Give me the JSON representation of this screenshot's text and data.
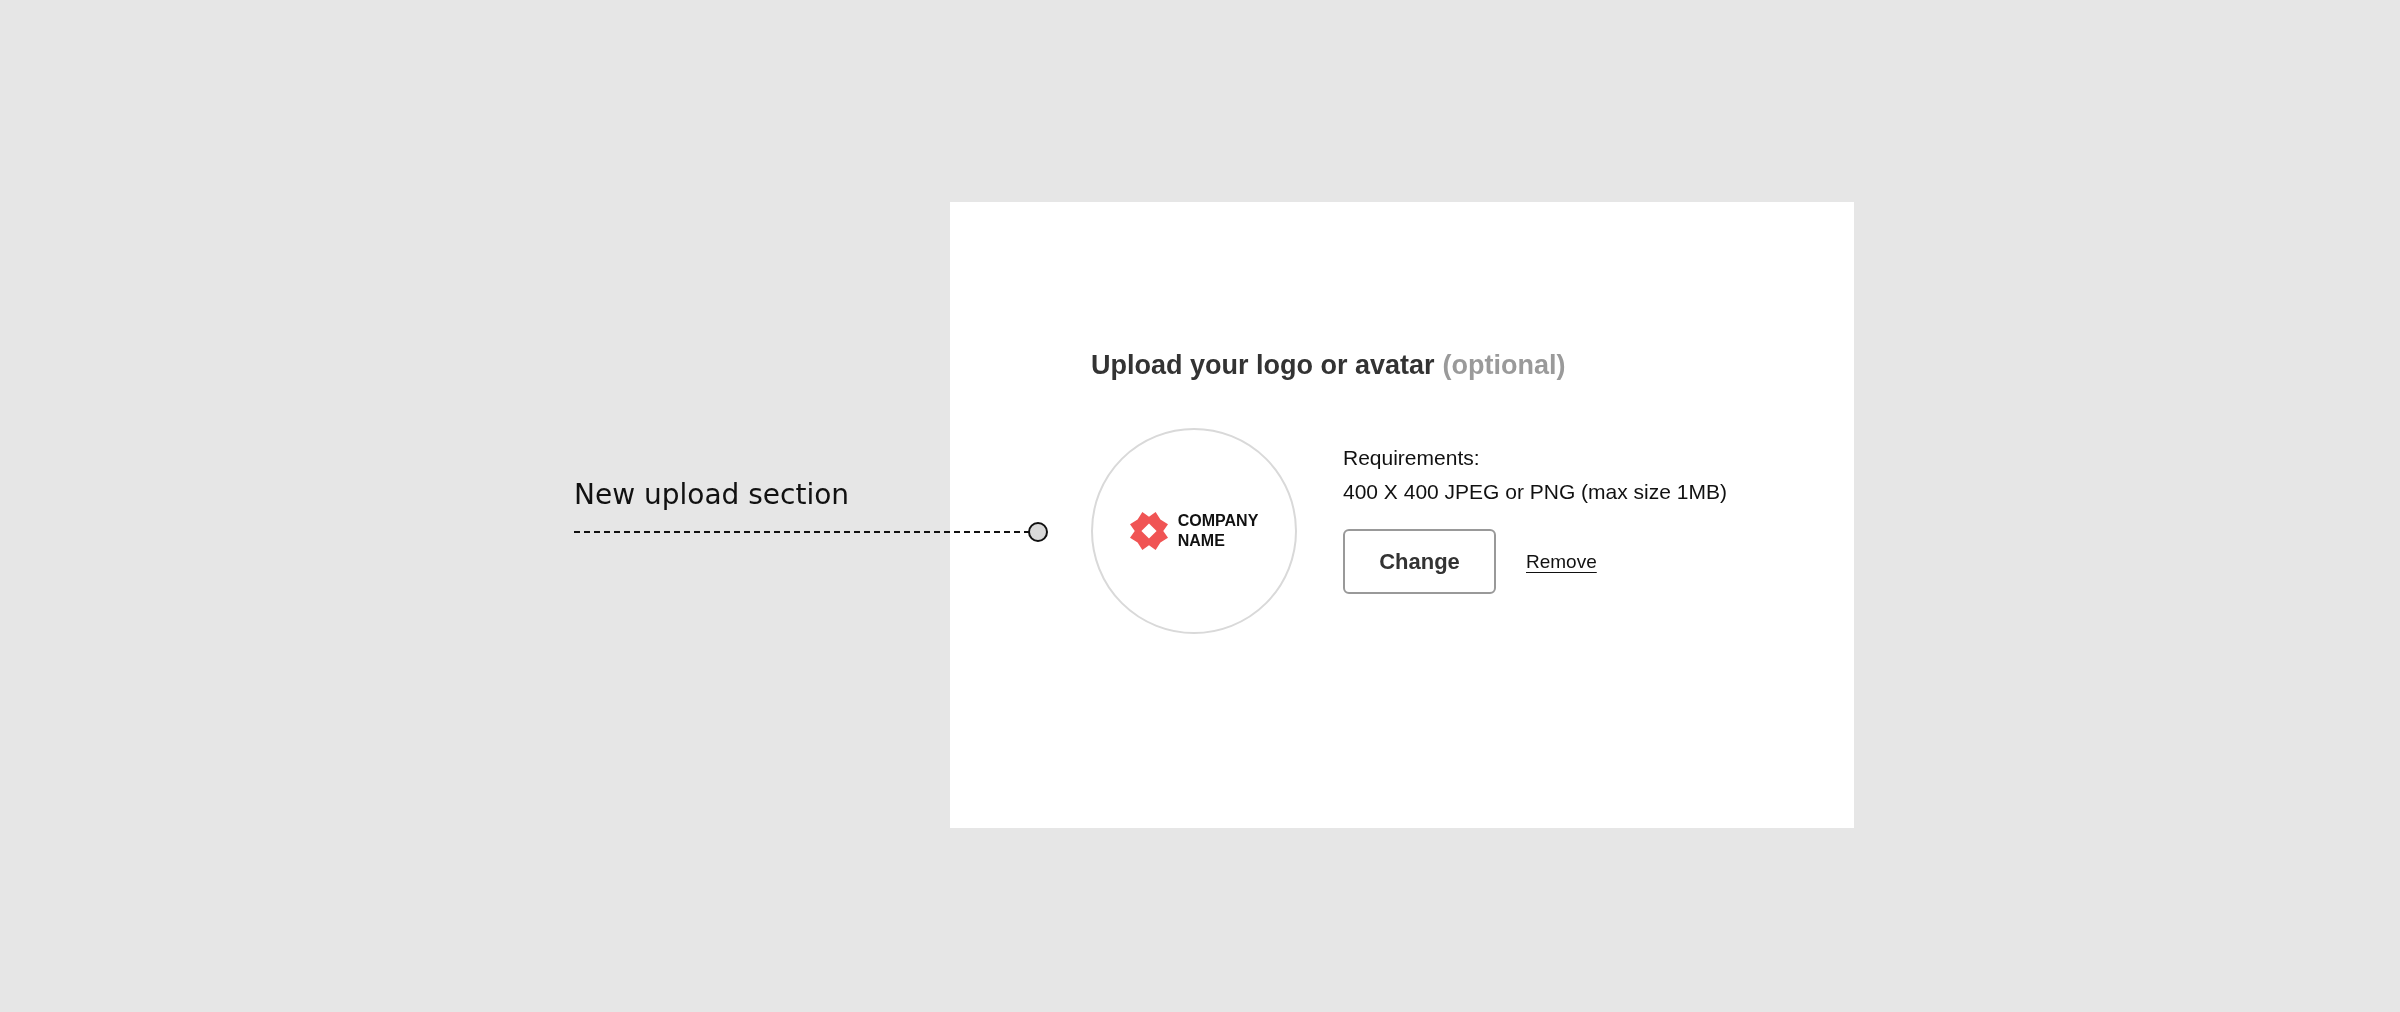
{
  "annotation": {
    "label": "New upload section"
  },
  "upload_section": {
    "title": "Upload your logo or avatar",
    "title_note": "(optional)",
    "logo": {
      "lines": [
        "COMPANY",
        "NAME"
      ]
    },
    "requirements_label": "Requirements:",
    "requirements": "400 X 400 JPEG or PNG (max size 1MB)",
    "buttons": [
      {
        "kind": "outlined",
        "label": "Change"
      },
      {
        "kind": "link",
        "label": "Remove"
      }
    ]
  }
}
